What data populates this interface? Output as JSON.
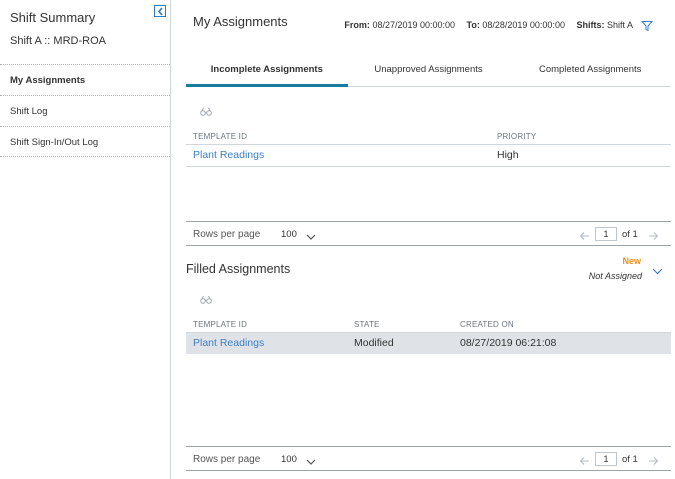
{
  "sidebar": {
    "title": "Shift Summary",
    "subtitle": "Shift A :: MRD-ROA",
    "items": [
      {
        "label": "My Assignments",
        "active": true
      },
      {
        "label": "Shift Log",
        "active": false
      },
      {
        "label": "Shift Sign-In/Out Log",
        "active": false
      }
    ]
  },
  "header": {
    "title": "My Assignments",
    "from_label": "From:",
    "from_value": "08/27/2019 00:00:00",
    "to_label": "To:",
    "to_value": "08/28/2019 00:00:00",
    "shifts_label": "Shifts:",
    "shifts_value": "Shift A"
  },
  "tabs": [
    {
      "label": "Incomplete Assignments",
      "active": true
    },
    {
      "label": "Unapproved Assignments",
      "active": false
    },
    {
      "label": "Completed Assignments",
      "active": false
    }
  ],
  "incomplete": {
    "columns": [
      "TEMPLATE ID",
      "PRIORITY"
    ],
    "rows": [
      {
        "template_id": "Plant Readings",
        "priority": "High"
      }
    ],
    "pager": {
      "rows_per_page_label": "Rows per page",
      "rows_per_page": "100",
      "page": "1",
      "of_label": "of 1"
    }
  },
  "filled": {
    "title": "Filled Assignments",
    "badge_new": "New",
    "badge_status": "Not Assigned",
    "columns": [
      "TEMPLATE ID",
      "STATE",
      "CREATED ON"
    ],
    "rows": [
      {
        "template_id": "Plant Readings",
        "state": "Modified",
        "created_on": "08/27/2019 06:21:08"
      }
    ],
    "pager": {
      "rows_per_page_label": "Rows per page",
      "rows_per_page": "100",
      "page": "1",
      "of_label": "of 1"
    }
  },
  "colors": {
    "accent": "#197b9f",
    "link": "#3d7fc4",
    "new_badge": "#e8911e"
  }
}
